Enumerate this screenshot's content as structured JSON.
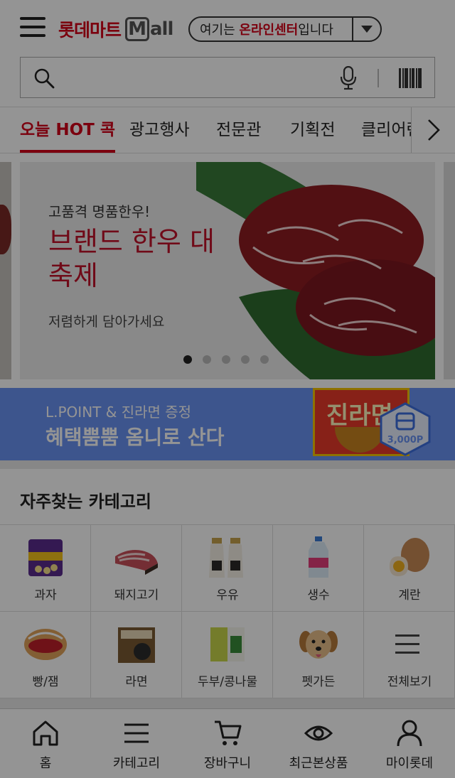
{
  "header": {
    "menu_icon": "hamburger-menu-icon",
    "logo_text": "롯데마트",
    "logo_m": "M",
    "logo_all": "all",
    "center_select": {
      "prefix": "여기는 ",
      "highlight": "온라인센터",
      "suffix": "입니다",
      "arrow_icon": "caret-down-icon"
    }
  },
  "search": {
    "placeholder": "",
    "search_icon": "search-icon",
    "mic_icon": "microphone-icon",
    "barcode_icon": "barcode-icon"
  },
  "tabs": [
    {
      "label": "오늘 HOT 콕",
      "active": true
    },
    {
      "label": "광고행사",
      "active": false
    },
    {
      "label": "전문관",
      "active": false
    },
    {
      "label": "기획전",
      "active": false
    },
    {
      "label": "클리어런스",
      "active": false
    }
  ],
  "tabs_next_icon": "chevron-right-icon",
  "banner": {
    "subtitle": "고품격 명품한우!",
    "title": "브랜드 한우 대축제",
    "description": "저렴하게 담아가세요",
    "image": "marbled-beef-on-bamboo-leaf",
    "slide_count": 5,
    "active_slide": 1
  },
  "promo": {
    "line1": "L.POINT & 진라면 증정",
    "line2": "혜택뿜뿜 옴니로 산다",
    "pack_label": "진라면",
    "badge": "3,000P"
  },
  "categories": {
    "heading": "자주찾는 카테고리",
    "items": [
      {
        "label": "과자",
        "icon": "snack-bag-icon"
      },
      {
        "label": "돼지고기",
        "icon": "pork-belly-icon"
      },
      {
        "label": "우유",
        "icon": "milk-bottle-icon"
      },
      {
        "label": "생수",
        "icon": "water-bottle-icon"
      },
      {
        "label": "계란",
        "icon": "egg-icon"
      },
      {
        "label": "빵/잼",
        "icon": "bread-icon"
      },
      {
        "label": "라면",
        "icon": "ramen-icon"
      },
      {
        "label": "두부/콩나물",
        "icon": "tofu-icon"
      },
      {
        "label": "펫가든",
        "icon": "puppy-icon"
      },
      {
        "label": "전체보기",
        "icon": "list-menu-icon"
      }
    ]
  },
  "bottom_nav": [
    {
      "label": "홈",
      "icon": "home-icon"
    },
    {
      "label": "카테고리",
      "icon": "category-menu-icon"
    },
    {
      "label": "장바구니",
      "icon": "cart-icon"
    },
    {
      "label": "최근본상품",
      "icon": "eye-icon"
    },
    {
      "label": "마이롯데",
      "icon": "user-icon"
    }
  ],
  "colors": {
    "brand_red": "#d50019",
    "promo_blue": "#6a93f3",
    "overlay": "rgba(0,0,0,0.42)"
  }
}
